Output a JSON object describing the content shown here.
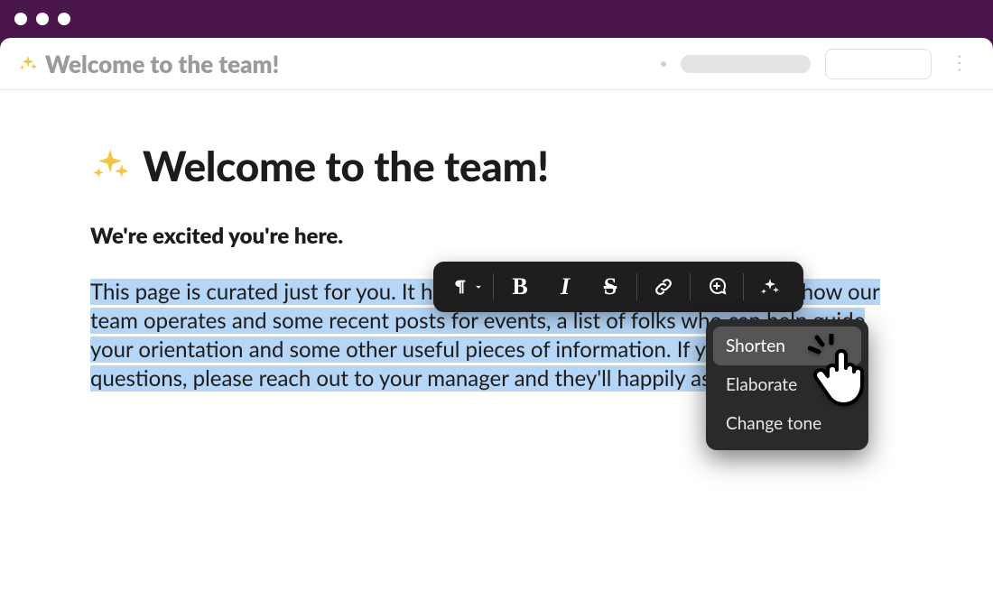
{
  "tab": {
    "icon": "sparkle-icon",
    "title": "Welcome to the team!"
  },
  "doc": {
    "icon": "sparkle-icon",
    "title": "Welcome to the team!",
    "subhead": "We're excited you're here.",
    "paragraph": "This page is curated just for you. It has everything you need to know about how our team operates and some recent posts for events, a list of folks who can help guide your orientation and some other useful pieces of information. If you have any questions, please reach out to your manager and they'll happily assist."
  },
  "toolbar": {
    "paragraph_label": "¶",
    "bold_label": "B",
    "italic_label": "I",
    "strike_label": "S",
    "icons": {
      "paragraph": "paragraph-icon",
      "bold": "bold-icon",
      "italic": "italic-icon",
      "strike": "strikethrough-icon",
      "link": "link-icon",
      "comment": "add-comment-icon",
      "ai": "sparkle-icon"
    }
  },
  "ai_menu": {
    "items": [
      {
        "label": "Shorten",
        "selected": true
      },
      {
        "label": "Elaborate",
        "selected": false
      },
      {
        "label": "Change tone",
        "selected": false
      }
    ]
  },
  "colors": {
    "window_frame": "#4a154b",
    "selection": "#b5d6f6",
    "toolbar_bg": "#1e1e1e",
    "menu_bg": "#2a2a2a",
    "sparkle": "#f2c744"
  }
}
